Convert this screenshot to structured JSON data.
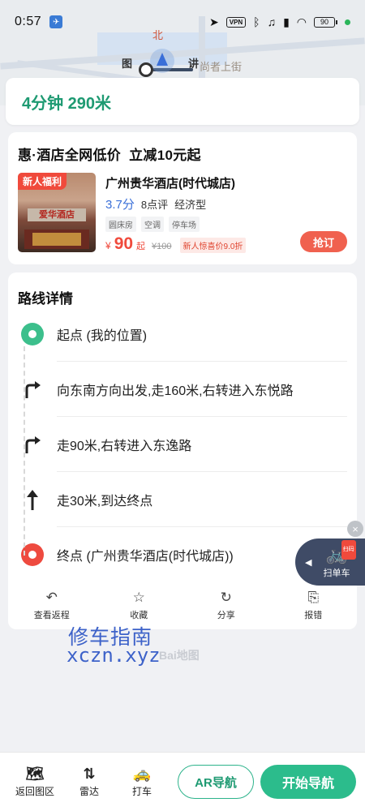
{
  "status_bar": {
    "time": "0:57",
    "battery": "90",
    "vpn": "VPN"
  },
  "map": {
    "labels": [
      "北",
      "尚者上街",
      "图",
      "讲"
    ]
  },
  "summary": {
    "text": "4分钟 290米"
  },
  "hotel_card": {
    "promo_title": "惠·酒店全网低价  立减10元起",
    "badge": "新人福利",
    "image_sign": "爱华酒店",
    "name": "广州贵华酒店(时代城店)",
    "score": "3.7分",
    "reviews": "8点评",
    "category": "经济型",
    "tags": [
      "圆床房",
      "空调",
      "停车场"
    ],
    "price_symbol": "¥",
    "price": "90",
    "price_suffix": "起",
    "old_price": "¥100",
    "discount": "新人惊喜价9.0折",
    "book_label": "抢订"
  },
  "route": {
    "title": "路线详情",
    "steps": [
      {
        "icon": "start-pin-icon",
        "text": "起点 (我的位置)"
      },
      {
        "icon": "turn-right-icon",
        "text": "向东南方向出发,走160米,右转进入东悦路"
      },
      {
        "icon": "turn-right-icon",
        "text": "走90米,右转进入东逸路"
      },
      {
        "icon": "straight-arrow-icon",
        "text": "走30米,到达终点"
      },
      {
        "icon": "end-pin-icon",
        "text": "终点 (广州贵华酒店(时代城店))"
      }
    ],
    "actions": [
      {
        "icon": "return-icon",
        "label": "查看返程"
      },
      {
        "icon": "star-icon",
        "label": "收藏"
      },
      {
        "icon": "share-icon",
        "label": "分享"
      },
      {
        "icon": "report-icon",
        "label": "报错"
      }
    ]
  },
  "float_bike": {
    "label": "扫单车",
    "badge": "扫码"
  },
  "watermark": {
    "line1": "修车指南",
    "line2": "xczn.xyz",
    "brand": "Bai地图"
  },
  "bottom_bar": {
    "items": [
      {
        "icon": "map-icon",
        "label": "返回图区"
      },
      {
        "icon": "radar-icon",
        "label": "雷达"
      },
      {
        "icon": "taxi-icon",
        "label": "打车"
      }
    ],
    "ar_label": "AR导航",
    "start_label": "开始导航"
  },
  "colors": {
    "accent_green": "#1e9a72",
    "button_green": "#2cbc8c",
    "accent_red": "#f04a3c",
    "score_blue": "#3a6fd8"
  }
}
